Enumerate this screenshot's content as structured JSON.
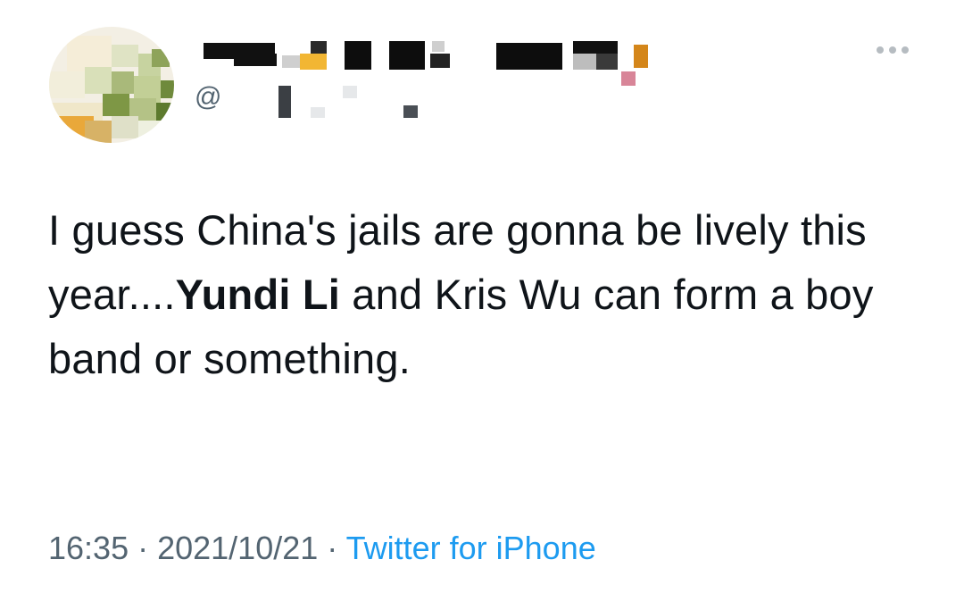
{
  "tweet": {
    "handle_prefix": "@",
    "text": {
      "part1": "I guess China's jails are gonna be lively this year....",
      "bold": "Yundi Li",
      "part2": " and Kris Wu can form a boy band or something."
    },
    "meta": {
      "time": "16:35",
      "separator1": " · ",
      "date": "2021/10/21",
      "separator2": " · ",
      "source": "Twitter for iPhone"
    }
  },
  "colors": {
    "text": "#0f1419",
    "secondary": "#536471",
    "link": "#1d9bf0",
    "more_dots": "#b6bcc1"
  },
  "icons": {
    "more": "ellipsis-icon"
  }
}
